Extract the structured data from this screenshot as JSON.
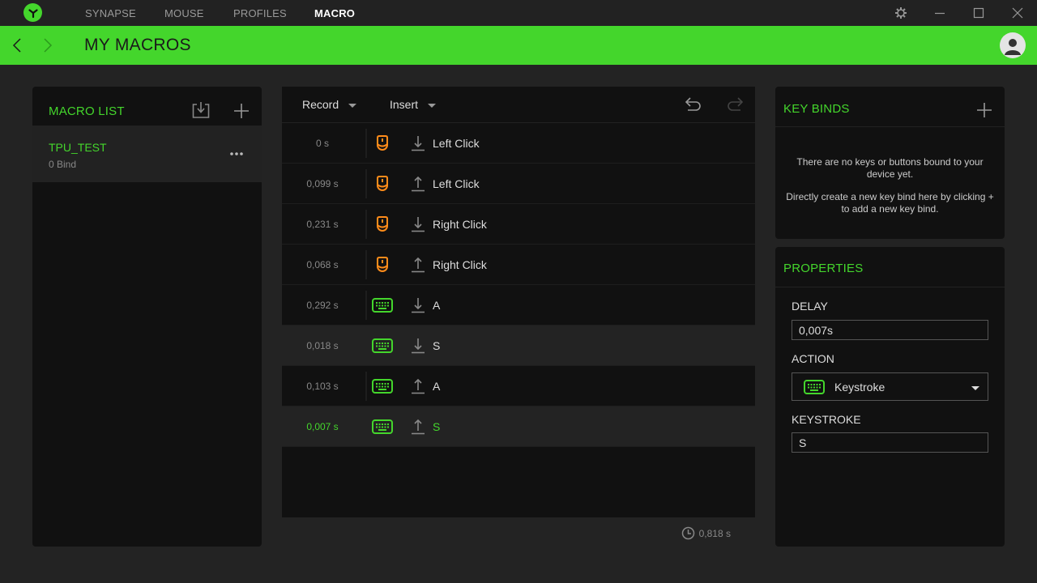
{
  "titlebar": {
    "tabs": [
      {
        "label": "SYNAPSE",
        "active": false
      },
      {
        "label": "MOUSE",
        "active": false
      },
      {
        "label": "PROFILES",
        "active": false
      },
      {
        "label": "MACRO",
        "active": true
      }
    ],
    "icons": [
      "settings-icon",
      "minimize-icon",
      "maximize-icon",
      "close-icon"
    ]
  },
  "header": {
    "title": "MY MACROS"
  },
  "macro_list": {
    "title": "MACRO LIST",
    "items": [
      {
        "name": "TPU_TEST",
        "binds": "0 Bind"
      }
    ]
  },
  "editor": {
    "record_label": "Record",
    "insert_label": "Insert",
    "rows": [
      {
        "delay": "0 s",
        "device": "mouse",
        "direction": "down",
        "label": "Left Click"
      },
      {
        "delay": "0,099 s",
        "device": "mouse",
        "direction": "up",
        "label": "Left Click"
      },
      {
        "delay": "0,231 s",
        "device": "mouse",
        "direction": "down",
        "label": "Right Click"
      },
      {
        "delay": "0,068 s",
        "device": "mouse",
        "direction": "up",
        "label": "Right Click"
      },
      {
        "delay": "0,292 s",
        "device": "keyboard",
        "direction": "down",
        "label": "A"
      },
      {
        "delay": "0,018 s",
        "device": "keyboard",
        "direction": "down",
        "label": "S"
      },
      {
        "delay": "0,103 s",
        "device": "keyboard",
        "direction": "up",
        "label": "A"
      },
      {
        "delay": "0,007 s",
        "device": "keyboard",
        "direction": "up",
        "label": "S",
        "selected": true
      }
    ],
    "total_time": "0,818 s"
  },
  "key_binds": {
    "title": "KEY BINDS",
    "empty_line1": "There are no keys or buttons bound to your device yet.",
    "empty_line2": "Directly create a new key bind here by clicking + to add a new key bind."
  },
  "properties": {
    "title": "PROPERTIES",
    "delay_label": "DELAY",
    "delay_value": "0,007s",
    "action_label": "ACTION",
    "action_value": "Keystroke",
    "keystroke_label": "KEYSTROKE",
    "keystroke_value": "S"
  },
  "colors": {
    "accent": "#44d62c",
    "mouse_icon": "#ff8c1a",
    "background": "#232323",
    "panel": "#111111"
  }
}
